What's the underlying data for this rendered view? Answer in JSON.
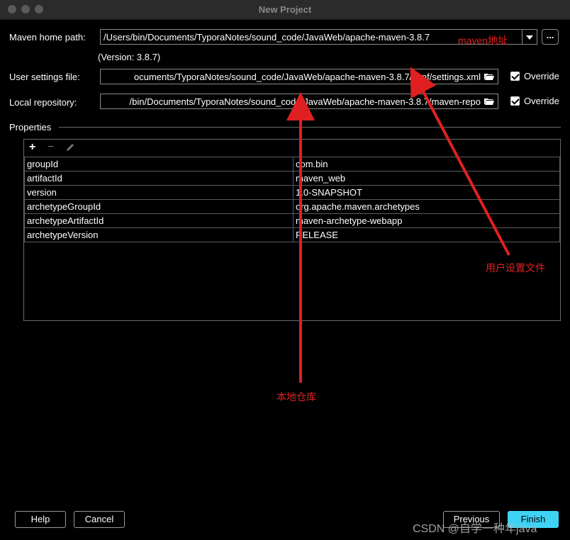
{
  "window": {
    "title": "New Project"
  },
  "maven": {
    "home_label": "Maven home path:",
    "home_value": "/Users/bin/Documents/TyporaNotes/sound_code/JavaWeb/apache-maven-3.8.7",
    "version_text": "(Version: 3.8.7)",
    "browse_label": "...",
    "settings_label": "User settings file:",
    "settings_value": "ocuments/TyporaNotes/sound_code/JavaWeb/apache-maven-3.8.7/conf/settings.xml",
    "settings_override": "Override",
    "repo_label": "Local repository:",
    "repo_value": "/bin/Documents/TyporaNotes/sound_code/JavaWeb/apache-maven-3.8.7/maven-repo",
    "repo_override": "Override"
  },
  "properties": {
    "section_label": "Properties",
    "toolbar": {
      "add": "+",
      "remove": "−"
    },
    "rows": [
      {
        "key": "groupId",
        "value": "com.bin"
      },
      {
        "key": "artifactId",
        "value": "maven_web"
      },
      {
        "key": "version",
        "value": "1.0-SNAPSHOT"
      },
      {
        "key": "archetypeGroupId",
        "value": "org.apache.maven.archetypes"
      },
      {
        "key": "archetypeArtifactId",
        "value": "maven-archetype-webapp"
      },
      {
        "key": "archetypeVersion",
        "value": "RELEASE"
      }
    ]
  },
  "footer": {
    "help": "Help",
    "cancel": "Cancel",
    "previous": "Previous",
    "finish": "Finish"
  },
  "annotations": {
    "maven_address": "maven地址",
    "user_settings": "用户设置文件",
    "local_repo": "本地仓库",
    "color": "#e02020"
  },
  "watermark": "CSDN @自学一种年java"
}
